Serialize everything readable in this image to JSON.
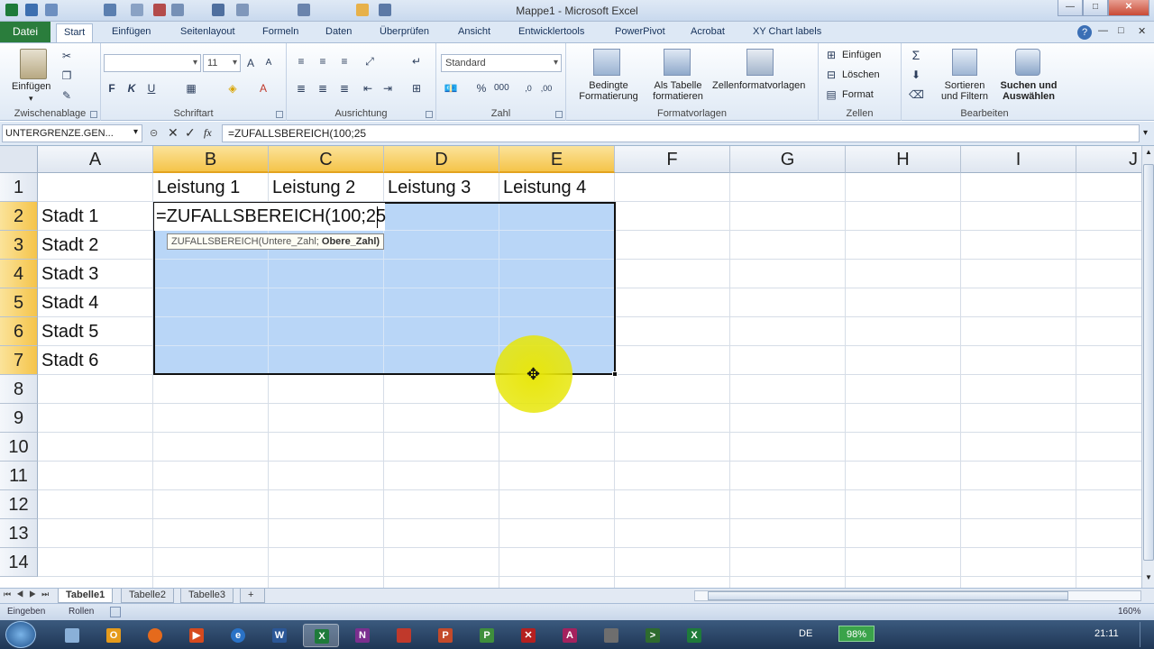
{
  "window": {
    "title": "Mappe1 - Microsoft Excel",
    "controls": {
      "minimize": "—",
      "maximize": "□",
      "close": "✕"
    }
  },
  "ribbon": {
    "tabs": [
      "Datei",
      "Start",
      "Einfügen",
      "Seitenlayout",
      "Formeln",
      "Daten",
      "Überprüfen",
      "Ansicht",
      "Entwicklertools",
      "PowerPivot",
      "Acrobat",
      "XY Chart labels"
    ],
    "active_tab": "Start",
    "groups": {
      "clipboard": {
        "label": "Zwischenablage",
        "paste": "Einfügen"
      },
      "font": {
        "label": "Schriftart",
        "font_name": "",
        "font_size": "11",
        "bold": "F",
        "italic": "K",
        "underline": "U"
      },
      "alignment": {
        "label": "Ausrichtung"
      },
      "number": {
        "label": "Zahl",
        "format": "Standard"
      },
      "styles": {
        "label": "Formatvorlagen",
        "conditional": "Bedingte Formatierung",
        "as_table": "Als Tabelle formatieren",
        "cell_styles": "Zellenformatvorlagen"
      },
      "cells": {
        "label": "Zellen",
        "insert": "Einfügen",
        "delete": "Löschen",
        "format": "Format"
      },
      "editing": {
        "label": "Bearbeiten",
        "sort": "Sortieren und Filtern",
        "find": "Suchen und Auswählen"
      }
    }
  },
  "formula_bar": {
    "name_box": "UNTERGRENZE.GEN...",
    "fx": "fx",
    "formula": "=ZUFALLSBEREICH(100;25"
  },
  "sheet": {
    "columns": [
      "A",
      "B",
      "C",
      "D",
      "E",
      "F",
      "G",
      "H",
      "I",
      "J"
    ],
    "rows": [
      "1",
      "2",
      "3",
      "4",
      "5",
      "6",
      "7",
      "8",
      "9",
      "10",
      "11",
      "12",
      "13",
      "14"
    ],
    "headers_row1": [
      "Leistung 1",
      "Leistung 2",
      "Leistung 3",
      "Leistung 4"
    ],
    "cities": [
      "Stadt 1",
      "Stadt 2",
      "Stadt 3",
      "Stadt 4",
      "Stadt 5",
      "Stadt 6"
    ],
    "edit_text": "=ZUFALLSBEREICH(100;25",
    "tooltip_normal": "ZUFALLSBEREICH(Untere_Zahl; ",
    "tooltip_bold": "Obere_Zahl)"
  },
  "sheet_tabs": [
    "Tabelle1",
    "Tabelle2",
    "Tabelle3"
  ],
  "active_sheet": "Tabelle1",
  "status_bar": {
    "mode": "Eingeben",
    "scroll": "Rollen",
    "zoom": "160%"
  },
  "taskbar": {
    "language": "DE",
    "battery": "98%",
    "clock": "21:11"
  },
  "colors": {
    "accent_file_tab": "#2a7d3c",
    "selection": "#b9d6f7",
    "header_selected": "#f5c44a"
  }
}
